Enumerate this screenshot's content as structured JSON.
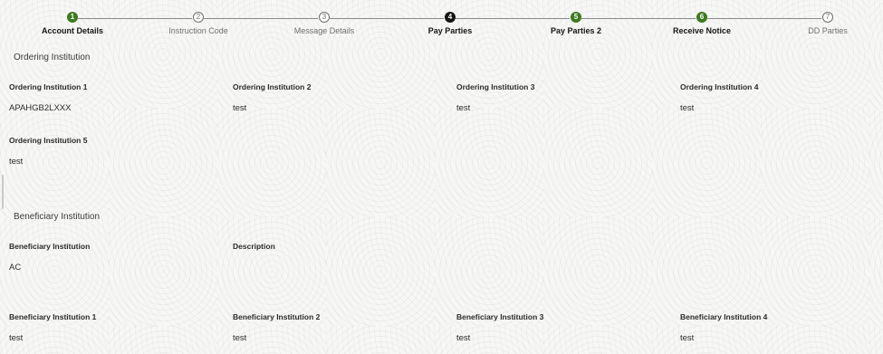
{
  "stepper": {
    "steps": [
      {
        "number": "1",
        "label": "Account Details",
        "state": "complete"
      },
      {
        "number": "2",
        "label": "Instruction Code",
        "state": "pending"
      },
      {
        "number": "3",
        "label": "Message Details",
        "state": "pending"
      },
      {
        "number": "4",
        "label": "Pay Parties",
        "state": "current"
      },
      {
        "number": "5",
        "label": "Pay Parties 2",
        "state": "complete"
      },
      {
        "number": "6",
        "label": "Receive Notice",
        "state": "complete"
      },
      {
        "number": "7",
        "label": "DD Parties",
        "state": "pending"
      }
    ]
  },
  "ordering": {
    "title": "Ordering Institution",
    "fields": [
      {
        "label": "Ordering Institution 1",
        "value": "APAHGB2LXXX"
      },
      {
        "label": "Ordering Institution 2",
        "value": "test"
      },
      {
        "label": "Ordering Institution 3",
        "value": "test"
      },
      {
        "label": "Ordering Institution 4",
        "value": "test"
      },
      {
        "label": "Ordering Institution 5",
        "value": "test"
      }
    ]
  },
  "beneficiary": {
    "title": "Beneficiary Institution",
    "fields": [
      {
        "label": "Beneficiary Institution",
        "value": "AC"
      },
      {
        "label": "Description",
        "value": ""
      },
      {
        "label": "Beneficiary Institution 1",
        "value": "test"
      },
      {
        "label": "Beneficiary Institution 2",
        "value": "test"
      },
      {
        "label": "Beneficiary Institution 3",
        "value": "test"
      },
      {
        "label": "Beneficiary Institution 4",
        "value": "test"
      }
    ]
  },
  "colors": {
    "complete": "#3d7a1f",
    "current": "#161513",
    "pending_border": "#6f6f6f"
  }
}
